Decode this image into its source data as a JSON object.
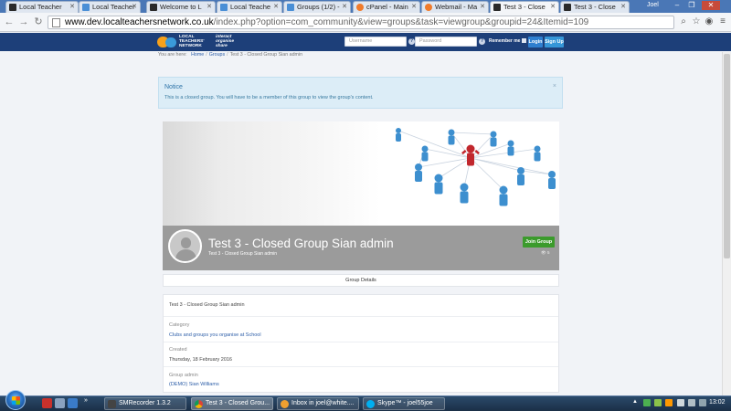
{
  "browser": {
    "tabs": [
      {
        "title": "Local Teacher",
        "active": false
      },
      {
        "title": "Local Teacher",
        "active": false
      },
      {
        "title": "Welcome to L",
        "active": false
      },
      {
        "title": "Local Teache",
        "active": false
      },
      {
        "title": "Groups (1/2) -",
        "active": false
      },
      {
        "title": "cPanel - Main",
        "active": false
      },
      {
        "title": "Webmail - Ma",
        "active": false
      },
      {
        "title": "Test 3 - Close",
        "active": true
      },
      {
        "title": "Test 3 - Close",
        "active": false
      }
    ],
    "user": "Joel",
    "url_host": "www.dev.localteachersnetwork.co.uk",
    "url_path": "/index.php?option=com_community&view=groups&task=viewgroup&groupid=24&Itemid=109"
  },
  "site": {
    "logo_lines": [
      "LOCAL",
      "TEACHERS'",
      "NETWORK"
    ],
    "logo_tagline": [
      "interact",
      "organise",
      "share"
    ],
    "username_placeholder": "Username",
    "password_placeholder": "Password",
    "remember_label": "Remember me",
    "login_label": "Login",
    "signup_label": "Sign Up"
  },
  "breadcrumb": {
    "prefix": "You are here:",
    "items": [
      "Home",
      "Groups",
      "Test 3 - Closed Group Sian admin"
    ]
  },
  "notice": {
    "title": "Notice",
    "text": "This is a closed group. You will have to be a member of this group to view the group's content.",
    "close": "×"
  },
  "group": {
    "title": "Test 3 - Closed Group Sian admin",
    "subtitle": "Test 3 - Closed Group Sian admin",
    "join_label": "Join Group",
    "member_count": "5",
    "tab_label": "Group Details",
    "description": "Test 3 - Closed Group Sian admin",
    "fields": [
      {
        "label": "Category",
        "value": "Clubs and groups you organise at School",
        "link": true
      },
      {
        "label": "Created",
        "value": "Thursday, 18 February 2016",
        "link": false
      },
      {
        "label": "Group admin",
        "value": "(DEMO) Sian Williams",
        "link": true
      }
    ]
  },
  "taskbar": {
    "tasks": [
      {
        "label": "SMRecorder 1.3.2",
        "active": false
      },
      {
        "label": "Test 3 - Closed Grou...",
        "active": true
      },
      {
        "label": "Inbox in joel@white....",
        "active": false
      },
      {
        "label": "Skype™ - joel55joe",
        "active": false
      }
    ],
    "clock": "13:02"
  },
  "colors": {
    "header": "#1d3f79",
    "join": "#3b9b2c",
    "notice_bg": "#dcedf7",
    "link": "#2d5ea8"
  }
}
